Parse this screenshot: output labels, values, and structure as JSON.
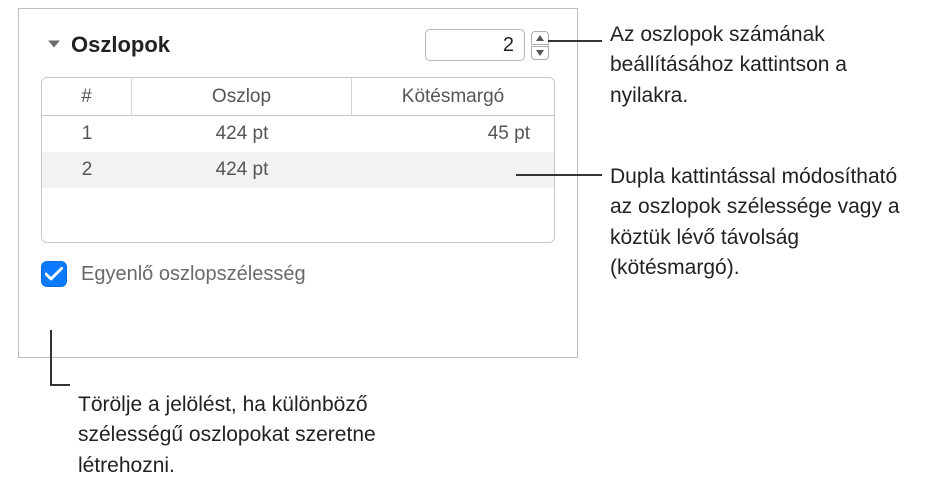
{
  "section": {
    "title": "Oszlopok",
    "stepper_value": "2"
  },
  "table": {
    "headers": {
      "index": "#",
      "column": "Oszlop",
      "gutter": "Kötésmargó"
    },
    "rows": [
      {
        "idx": "1",
        "width": "424 pt",
        "gutter": "45 pt"
      },
      {
        "idx": "2",
        "width": "424 pt",
        "gutter": ""
      }
    ]
  },
  "checkbox": {
    "label": "Egyenlő oszlopszélesség"
  },
  "callouts": {
    "c1": "Az oszlopok számának beállításához kattintson a nyilakra.",
    "c2": "Dupla kattintással módosítható az oszlopok szélessége vagy a köztük lévő távolság (kötésmargó).",
    "c3": "Törölje a jelölést, ha különböző szélességű oszlopokat szeretne létrehozni."
  }
}
